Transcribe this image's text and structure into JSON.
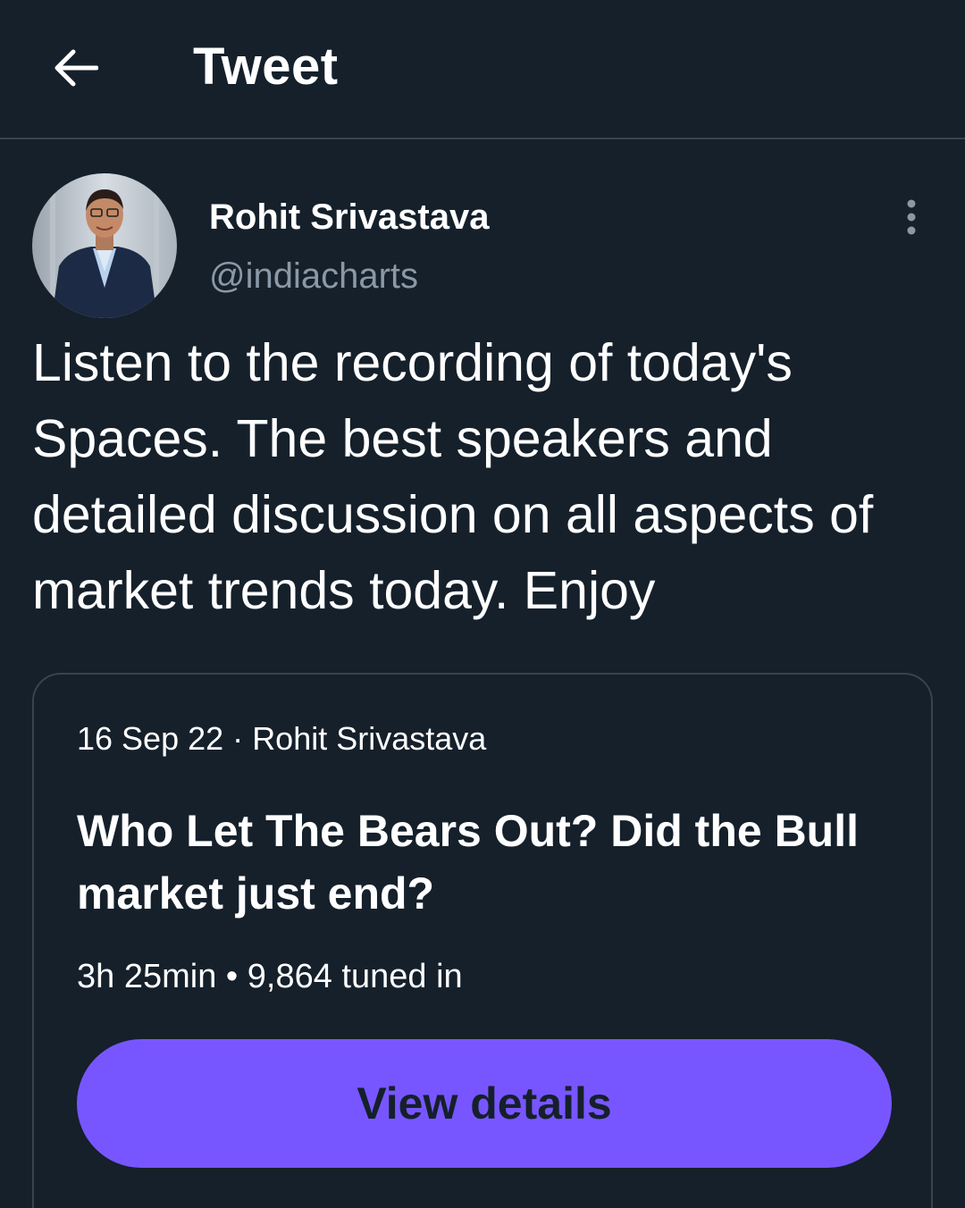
{
  "header": {
    "title": "Tweet",
    "back_icon": "arrow-left-icon"
  },
  "tweet": {
    "author": {
      "name": "Rohit Srivastava",
      "handle": "@indiacharts",
      "avatar": "profile-photo"
    },
    "more_icon": "more-vertical-icon",
    "text": "Listen to the recording of today's Spaces. The best speakers and detailed discussion on all aspects of market trends today. Enjoy"
  },
  "space_card": {
    "date": "16 Sep 22",
    "separator": "·",
    "host": "Rohit Srivastava",
    "title": "Who Let The Bears Out? Did the Bull market just end?",
    "duration": "3h 25min",
    "stats_separator": "•",
    "listeners": "9,864 tuned in",
    "button_label": "View details"
  },
  "colors": {
    "background": "#15202b",
    "border": "#38444d",
    "secondary_text": "#8b98a5",
    "spaces_accent": "#7856ff"
  }
}
